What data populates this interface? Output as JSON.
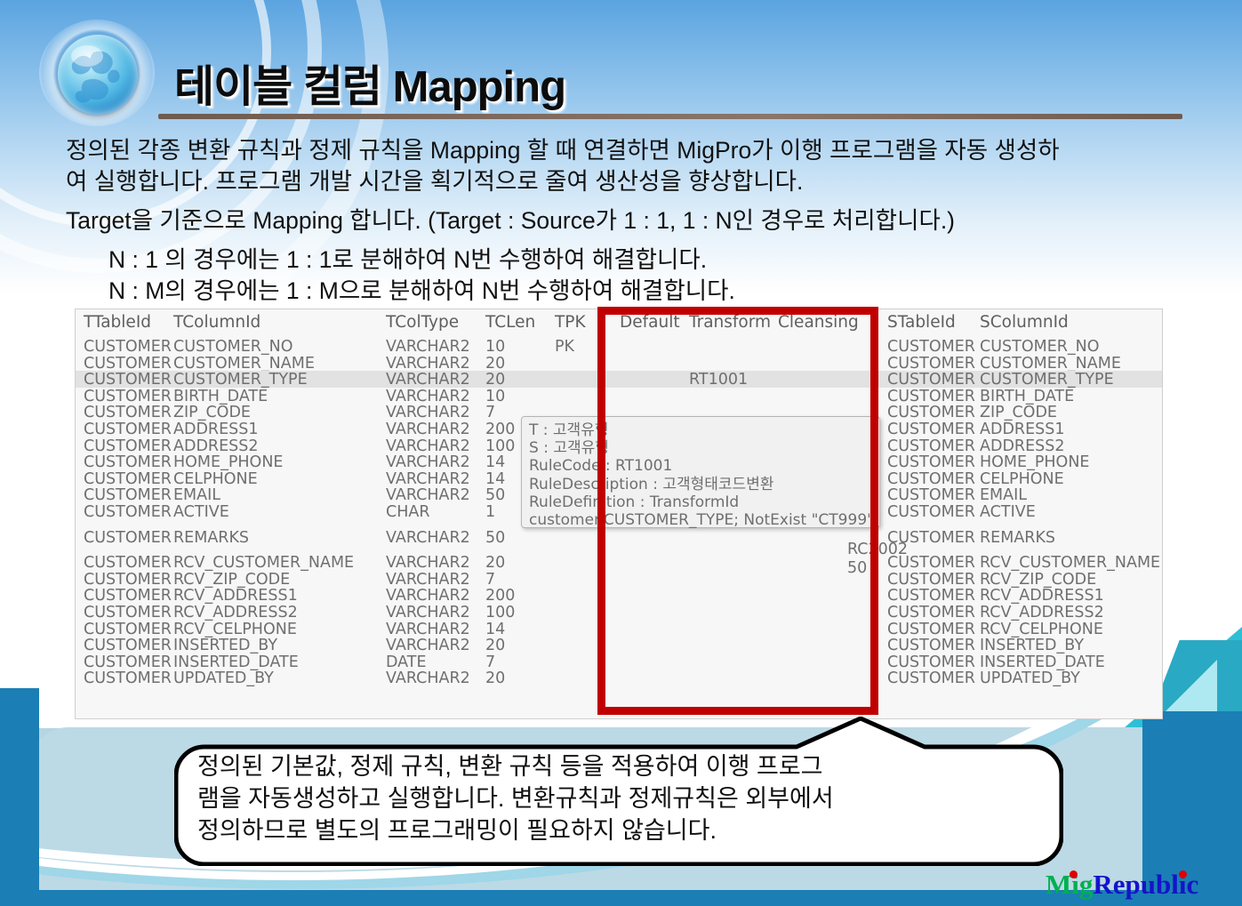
{
  "header": {
    "title": "테이블 컬럼 Mapping",
    "globe_icon": "globe-icon"
  },
  "body": {
    "paragraph1_line1": "정의된 각종 변환 규칙과 정제 규칙을 Mapping 할 때 연결하면 MigPro가 이행 프로그램을 자동 생성하",
    "paragraph1_line2": "여 실행합니다. 프로그램 개발 시간을 획기적으로 줄여 생산성을 향상합니다.",
    "paragraph2": "Target을 기준으로 Mapping 합니다. (Target : Source가 1 : 1,  1 : N인 경우로 처리합니다.)",
    "bullet1": "N : 1 의 경우에는 1 : 1로 분해하여 N번 수행하여 해결합니다.",
    "bullet2": "N : M의 경우에는 1 : M으로 분해하여 N번 수행하여 해결합니다."
  },
  "grid": {
    "headers": {
      "ttable": "TTableId",
      "tcolumn": "TColumnId",
      "tcoltype": "TColType",
      "tclen": "TCLen",
      "tpk": "TPK",
      "default": "Default",
      "transform": "Transform",
      "cleansing": "Cleansing",
      "stable": "STableId",
      "scolumn": "SColumnId"
    },
    "rows": [
      {
        "ttable": "CUSTOMER",
        "tcolumn": "CUSTOMER_NO",
        "type": "VARCHAR2",
        "len": "10",
        "pk": "PK",
        "def": "",
        "tr": "",
        "cl": "",
        "stable": "CUSTOMER",
        "scolumn": "CUSTOMER_NO",
        "selected": false
      },
      {
        "ttable": "CUSTOMER",
        "tcolumn": "CUSTOMER_NAME",
        "type": "VARCHAR2",
        "len": "20",
        "pk": "",
        "def": "",
        "tr": "",
        "cl": "",
        "stable": "CUSTOMER",
        "scolumn": "CUSTOMER_NAME",
        "selected": false
      },
      {
        "ttable": "CUSTOMER",
        "tcolumn": "CUSTOMER_TYPE",
        "type": "VARCHAR2",
        "len": "20",
        "pk": "",
        "def": "",
        "tr": "RT1001",
        "cl": "",
        "stable": "CUSTOMER",
        "scolumn": "CUSTOMER_TYPE",
        "selected": true
      },
      {
        "ttable": "CUSTOMER",
        "tcolumn": "BIRTH_DATE",
        "type": "VARCHAR2",
        "len": "10",
        "pk": "",
        "def": "",
        "tr": "",
        "cl": "",
        "stable": "CUSTOMER",
        "scolumn": "BIRTH_DATE",
        "selected": false
      },
      {
        "ttable": "CUSTOMER",
        "tcolumn": "ZIP_CODE",
        "type": "VARCHAR2",
        "len": "7",
        "pk": "",
        "def": "",
        "tr": "",
        "cl": "",
        "stable": "CUSTOMER",
        "scolumn": "ZIP_CODE",
        "selected": false
      },
      {
        "ttable": "CUSTOMER",
        "tcolumn": "ADDRESS1",
        "type": "VARCHAR2",
        "len": "200",
        "pk": "",
        "def": "",
        "tr": "",
        "cl": "",
        "stable": "CUSTOMER",
        "scolumn": "ADDRESS1",
        "selected": false
      },
      {
        "ttable": "CUSTOMER",
        "tcolumn": "ADDRESS2",
        "type": "VARCHAR2",
        "len": "100",
        "pk": "",
        "def": "",
        "tr": "",
        "cl": "",
        "stable": "CUSTOMER",
        "scolumn": "ADDRESS2",
        "selected": false
      },
      {
        "ttable": "CUSTOMER",
        "tcolumn": "HOME_PHONE",
        "type": "VARCHAR2",
        "len": "14",
        "pk": "",
        "def": "",
        "tr": "",
        "cl": "",
        "stable": "CUSTOMER",
        "scolumn": "HOME_PHONE",
        "selected": false
      },
      {
        "ttable": "CUSTOMER",
        "tcolumn": "CELPHONE",
        "type": "VARCHAR2",
        "len": "14",
        "pk": "",
        "def": "",
        "tr": "",
        "cl": "",
        "stable": "CUSTOMER",
        "scolumn": "CELPHONE",
        "selected": false
      },
      {
        "ttable": "CUSTOMER",
        "tcolumn": "EMAIL",
        "type": "VARCHAR2",
        "len": "50",
        "pk": "",
        "def": "",
        "tr": "",
        "cl": "",
        "stable": "CUSTOMER",
        "scolumn": "EMAIL",
        "selected": false
      },
      {
        "ttable": "CUSTOMER",
        "tcolumn": "ACTIVE",
        "type": "CHAR",
        "len": "1",
        "pk": "",
        "def": "",
        "tr": "",
        "cl": "",
        "stable": "CUSTOMER",
        "scolumn": "ACTIVE",
        "selected": false
      },
      {
        "ttable": "CUSTOMER",
        "tcolumn": "REMARKS",
        "type": "VARCHAR2",
        "len": "50",
        "pk": "",
        "def": "",
        "tr": "",
        "cl": "",
        "stable": "CUSTOMER",
        "scolumn": "REMARKS",
        "selected": false
      },
      {
        "ttable": "CUSTOMER",
        "tcolumn": "RCV_CUSTOMER_NAME",
        "type": "VARCHAR2",
        "len": "20",
        "pk": "",
        "def": "",
        "tr": "",
        "cl": "",
        "stable": "CUSTOMER",
        "scolumn": "RCV_CUSTOMER_NAME",
        "selected": false
      },
      {
        "ttable": "CUSTOMER",
        "tcolumn": "RCV_ZIP_CODE",
        "type": "VARCHAR2",
        "len": "7",
        "pk": "",
        "def": "",
        "tr": "",
        "cl": "",
        "stable": "CUSTOMER",
        "scolumn": "RCV_ZIP_CODE",
        "selected": false
      },
      {
        "ttable": "CUSTOMER",
        "tcolumn": "RCV_ADDRESS1",
        "type": "VARCHAR2",
        "len": "200",
        "pk": "",
        "def": "",
        "tr": "",
        "cl": "",
        "stable": "CUSTOMER",
        "scolumn": "RCV_ADDRESS1",
        "selected": false
      },
      {
        "ttable": "CUSTOMER",
        "tcolumn": "RCV_ADDRESS2",
        "type": "VARCHAR2",
        "len": "100",
        "pk": "",
        "def": "",
        "tr": "",
        "cl": "",
        "stable": "CUSTOMER",
        "scolumn": "RCV_ADDRESS2",
        "selected": false
      },
      {
        "ttable": "CUSTOMER",
        "tcolumn": "RCV_CELPHONE",
        "type": "VARCHAR2",
        "len": "14",
        "pk": "",
        "def": "",
        "tr": "",
        "cl": "",
        "stable": "CUSTOMER",
        "scolumn": "RCV_CELPHONE",
        "selected": false
      },
      {
        "ttable": "CUSTOMER",
        "tcolumn": "INSERTED_BY",
        "type": "VARCHAR2",
        "len": "20",
        "pk": "",
        "def": "",
        "tr": "",
        "cl": "",
        "stable": "CUSTOMER",
        "scolumn": "INSERTED_BY",
        "selected": false
      },
      {
        "ttable": "CUSTOMER",
        "tcolumn": "INSERTED_DATE",
        "type": "DATE",
        "len": "7",
        "pk": "",
        "def": "",
        "tr": "",
        "cl": "",
        "stable": "CUSTOMER",
        "scolumn": "INSERTED_DATE",
        "selected": false
      },
      {
        "ttable": "CUSTOMER",
        "tcolumn": "UPDATED_BY",
        "type": "VARCHAR2",
        "len": "20",
        "pk": "",
        "def": "",
        "tr": "",
        "cl": "",
        "stable": "CUSTOMER",
        "scolumn": "UPDATED_BY",
        "selected": false
      }
    ],
    "floating_values": {
      "cleansing_rule_code": "RC2002",
      "cleansing_length": "50"
    }
  },
  "tooltip": {
    "line1": "T : 고객유형",
    "line2": "S : 고객유형",
    "line3": "RuleCode : RT1001",
    "line4": "RuleDescription : 고객형태코드변환",
    "line5": "RuleDefinition : TransformId",
    "line6": "customer.CUSTOMER_TYPE; NotExist \"CT999\""
  },
  "callout": {
    "line1": "정의된 기본값, 정제 규칙, 변환 규칙 등을 적용하여 이행 프로그",
    "line2": "램을 자동생성하고 실행합니다. 변환규칙과 정제규칙은 외부에서",
    "line3": "정의하므로 별도의 프로그래밍이 필요하지 않습니다."
  },
  "logo": {
    "part1": "Mig",
    "part2": "Republic"
  },
  "colors": {
    "highlight_box": "#c00000",
    "header_gradient_top": "#5ba4e0",
    "accent_teal": "#2aa9c4",
    "accent_blue": "#1b7fb5",
    "logo_green": "#00b050",
    "logo_blue": "#1414c8",
    "logo_dot_red": "#e00000"
  }
}
